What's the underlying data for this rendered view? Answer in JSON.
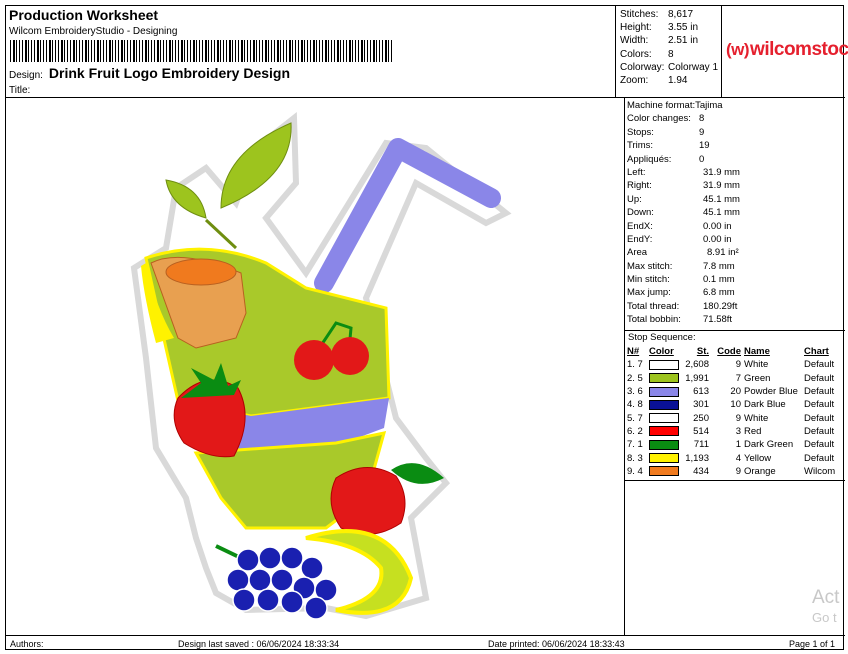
{
  "header": {
    "title": "Production Worksheet",
    "subtitle": "Wilcom EmbroideryStudio - Designing",
    "design_label": "Design:",
    "design_name": "Drink Fruit Logo Embroidery Design",
    "title_label": "Title:"
  },
  "stats": [
    {
      "label": "Stitches:",
      "value": "8,617"
    },
    {
      "label": "Height:",
      "value": "3.55 in"
    },
    {
      "label": "Width:",
      "value": "2.51 in"
    },
    {
      "label": "Colors:",
      "value": "8"
    },
    {
      "label": "Colorway:",
      "value": "Colorway 1"
    },
    {
      "label": "Zoom:",
      "value": "1.94"
    }
  ],
  "logo": {
    "icon": "(w)",
    "text": "wilcomstock",
    "color": "#e5202e"
  },
  "params_top": [
    {
      "label": "Machine format:",
      "value": "Tajima"
    },
    {
      "label": "Color changes:",
      "value": "8"
    },
    {
      "label": "Stops:",
      "value": "9"
    },
    {
      "label": "Trims:",
      "value": "19"
    },
    {
      "label": "Appliqués:",
      "value": "0"
    },
    {
      "label": "Left:",
      "value": "31.9 mm"
    },
    {
      "label": "Right:",
      "value": "31.9 mm"
    },
    {
      "label": "Up:",
      "value": "45.1 mm"
    },
    {
      "label": "Down:",
      "value": "45.1 mm"
    },
    {
      "label": "EndX:",
      "value": "0.00 in"
    },
    {
      "label": "EndY:",
      "value": "0.00 in"
    },
    {
      "label": "Area",
      "value": "8.91 in²"
    },
    {
      "label": "Max stitch:",
      "value": "7.8 mm"
    },
    {
      "label": "Min stitch:",
      "value": "0.1 mm"
    },
    {
      "label": "Max jump:",
      "value": "6.8 mm"
    },
    {
      "label": "Total thread:",
      "value": "180.29ft"
    },
    {
      "label": "Total bobbin:",
      "value": "71.58ft"
    }
  ],
  "sequence": {
    "title": "Stop Sequence:",
    "headers": {
      "n": "N#",
      "color": "Color",
      "st": "St.",
      "code": "Code",
      "name": "Name",
      "chart": "Chart"
    },
    "rows": [
      {
        "idx": "1. 7",
        "hex": "#ffffff",
        "st": "2,608",
        "code": "9",
        "name": "White",
        "chart": "Default"
      },
      {
        "idx": "2. 5",
        "hex": "#9dc41e",
        "st": "1,991",
        "code": "7",
        "name": "Green",
        "chart": "Default"
      },
      {
        "idx": "3. 6",
        "hex": "#8a86e8",
        "st": "613",
        "code": "20",
        "name": "Powder Blue",
        "chart": "Default"
      },
      {
        "idx": "4. 8",
        "hex": "#0a1196",
        "st": "301",
        "code": "10",
        "name": "Dark Blue",
        "chart": "Default"
      },
      {
        "idx": "5. 7",
        "hex": "#ffffff",
        "st": "250",
        "code": "9",
        "name": "White",
        "chart": "Default"
      },
      {
        "idx": "6. 2",
        "hex": "#ff0000",
        "st": "514",
        "code": "3",
        "name": "Red",
        "chart": "Default"
      },
      {
        "idx": "7. 1",
        "hex": "#0a8c12",
        "st": "711",
        "code": "1",
        "name": "Dark Green",
        "chart": "Default"
      },
      {
        "idx": "8. 3",
        "hex": "#fff200",
        "st": "1,193",
        "code": "4",
        "name": "Yellow",
        "chart": "Default"
      },
      {
        "idx": "9. 4",
        "hex": "#f07a1e",
        "st": "434",
        "code": "9",
        "name": "Orange",
        "chart": "Wilcom"
      }
    ]
  },
  "footer": {
    "authors": "Authors:",
    "saved": "Design last saved : 06/06/2024 18:33:34",
    "printed": "Date printed: 06/06/2024 18:33:43",
    "page": "Page 1 of 1"
  },
  "watermark": {
    "line1": "Act",
    "line2": "Go t"
  }
}
